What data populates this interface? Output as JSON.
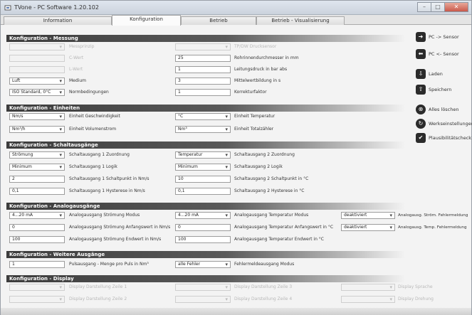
{
  "window": {
    "title": "TVone - PC Software 1.20.102"
  },
  "tabs": [
    "Information",
    "Konfiguration",
    "Betrieb",
    "Betrieb - Visualisierung"
  ],
  "sections": {
    "messung": "Konfiguration - Messung",
    "einheiten": "Konfiguration - Einheiten",
    "schalt": "Konfiguration - Schaltausgänge",
    "analog": "Konfiguration - Analogausgänge",
    "weitere": "Konfiguration - Weitere Ausgänge",
    "display": "Konfiguration - Display"
  },
  "messung": {
    "messprinzip": {
      "value": "",
      "label": "Messprinzip"
    },
    "c_wert": {
      "value": "",
      "label": "C-Wert"
    },
    "l_wert": {
      "value": "",
      "label": "L-Wert"
    },
    "medium": {
      "value": "Luft",
      "label": "Medium"
    },
    "normbedingungen": {
      "value": "ISO Standard, 0°C",
      "label": "Normbedingungen"
    },
    "tp_sensor": {
      "value": "",
      "label": "TP/DW Drucksensor"
    },
    "rohrinnen": {
      "value": "25",
      "label": "Rohrinnendurchmesser in mm"
    },
    "leitungsdruck": {
      "value": "1",
      "label": "Leitungsdruck in bar abs"
    },
    "mittelwert": {
      "value": "3",
      "label": "Mittelwertbildung in s"
    },
    "korrektur": {
      "value": "1",
      "label": "Korrekturfaktor"
    }
  },
  "einheiten": {
    "geschw": {
      "value": "Nm/s",
      "label": "Einheit Geschwindigkeit"
    },
    "volumen": {
      "value": "Nm³/h",
      "label": "Einheit Volumenstrom"
    },
    "temperatur": {
      "value": "°C",
      "label": "Einheit Temperatur"
    },
    "total": {
      "value": "Nm³",
      "label": "Einheit Totalzähler"
    }
  },
  "schalt": {
    "a1_zuordnung": {
      "value": "Strömung",
      "label": "Schaltausgang 1 Zuordnung"
    },
    "a1_logik": {
      "value": "Minimum",
      "label": "Schaltausgang 1 Logik"
    },
    "a1_schaltpunkt": {
      "value": "2",
      "label": "Schaltausgang 1 Schaltpunkt in Nm/s"
    },
    "a1_hysterese": {
      "value": "0,1",
      "label": "Schaltausgang 1 Hysterese in Nm/s"
    },
    "a2_zuordnung": {
      "value": "Temperatur",
      "label": "Schaltausgang 2 Zuordnung"
    },
    "a2_logik": {
      "value": "Minimum",
      "label": "Schaltausgang 2 Logik"
    },
    "a2_schaltpunkt": {
      "value": "10",
      "label": "Schaltausgang 2 Schaltpunkt in °C"
    },
    "a2_hysterese": {
      "value": "0,1",
      "label": "Schaltausgang 2 Hysterese in °C"
    }
  },
  "analog": {
    "str_modus": {
      "value": "4...20 mA",
      "label": "Analogausgang Strömung Modus"
    },
    "str_anfang": {
      "value": "0",
      "label": "Analogausgang Strömung Anfangswert in Nm/s"
    },
    "str_end": {
      "value": "100",
      "label": "Analogausgang Strömung Endwert in Nm/s"
    },
    "temp_modus": {
      "value": "4...20 mA",
      "label": "Analogausgang Temperatur Modus"
    },
    "temp_anfang": {
      "value": "0",
      "label": "Analogausgang Temperatur Anfangswert in °C"
    },
    "temp_end": {
      "value": "100",
      "label": "Analogausgang Temperatur Endwert in °C"
    },
    "str_fehler": {
      "value": "deaktiviert",
      "label": "Analogausg. Ström. Fehlermeldung"
    },
    "temp_fehler": {
      "value": "deaktiviert",
      "label": "Analogausg. Temp. Fehlermeldung"
    }
  },
  "weitere": {
    "puls": {
      "value": "1",
      "label": "Pulsausgang - Menge pro Puls in Nm³"
    },
    "fehler": {
      "value": "alle Fehler",
      "label": "Fehlermeldeausgang Modus"
    }
  },
  "display": {
    "z1": {
      "value": "",
      "label": "Display Darstellung Zeile 1"
    },
    "z2": {
      "value": "",
      "label": "Display Darstellung Zeile 2"
    },
    "z3": {
      "value": "",
      "label": "Display Darstellung Zeile 3"
    },
    "z4": {
      "value": "",
      "label": "Display Darstellung Zeile 4"
    },
    "sprache": {
      "value": "",
      "label": "Display Sprache"
    },
    "drehung": {
      "value": "",
      "label": "Display Drehung"
    }
  },
  "side": {
    "pc_sensor": "PC -> Sensor",
    "sensor_pc": "PC <- Sensor",
    "laden": "Laden",
    "speichern": "Speichern",
    "alles_loeschen": "Alles löschen",
    "werkseinstellungen": "Werkseinstellungen",
    "plausi": "Plausibilitätscheck"
  },
  "icons": {
    "app": "app-icon",
    "pc_sensor": "arrow-right-icon",
    "sensor_pc": "arrow-left-icon",
    "laden": "load-icon",
    "speichern": "save-icon",
    "alles_loeschen": "erase-icon",
    "werkseinstellungen": "reset-icon",
    "plausi": "check-icon"
  }
}
